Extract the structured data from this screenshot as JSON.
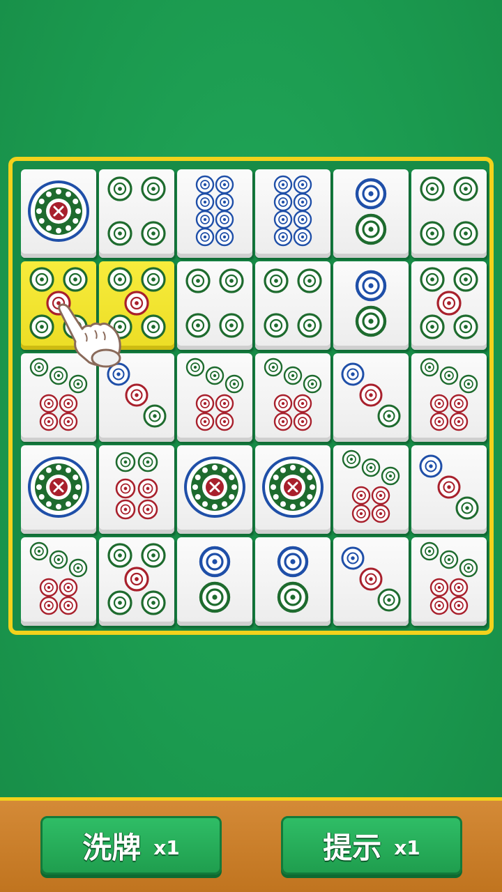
{
  "colors": {
    "green": "#1e6b2e",
    "red": "#a8202c",
    "blue": "#1f4fa8",
    "board_border": "#f2d21c",
    "selected_tile": "#f5e93a"
  },
  "board": {
    "rows": [
      [
        "1",
        "4",
        "8",
        "8",
        "2",
        "4"
      ],
      [
        "5",
        "5",
        "4",
        "4",
        "2",
        "5"
      ],
      [
        "7",
        "3",
        "7",
        "7",
        "3",
        "7"
      ],
      [
        "1",
        "6",
        "1",
        "1",
        "7",
        "3"
      ],
      [
        "7",
        "5",
        "2",
        "2",
        "3",
        "7"
      ]
    ],
    "selected": [
      [
        1,
        0
      ],
      [
        1,
        1
      ]
    ]
  },
  "hint_pointer": "pointing-hand-icon",
  "buttons": {
    "shuffle": {
      "label": "洗牌",
      "count": "x1"
    },
    "hint": {
      "label": "提示",
      "count": "x1"
    }
  }
}
